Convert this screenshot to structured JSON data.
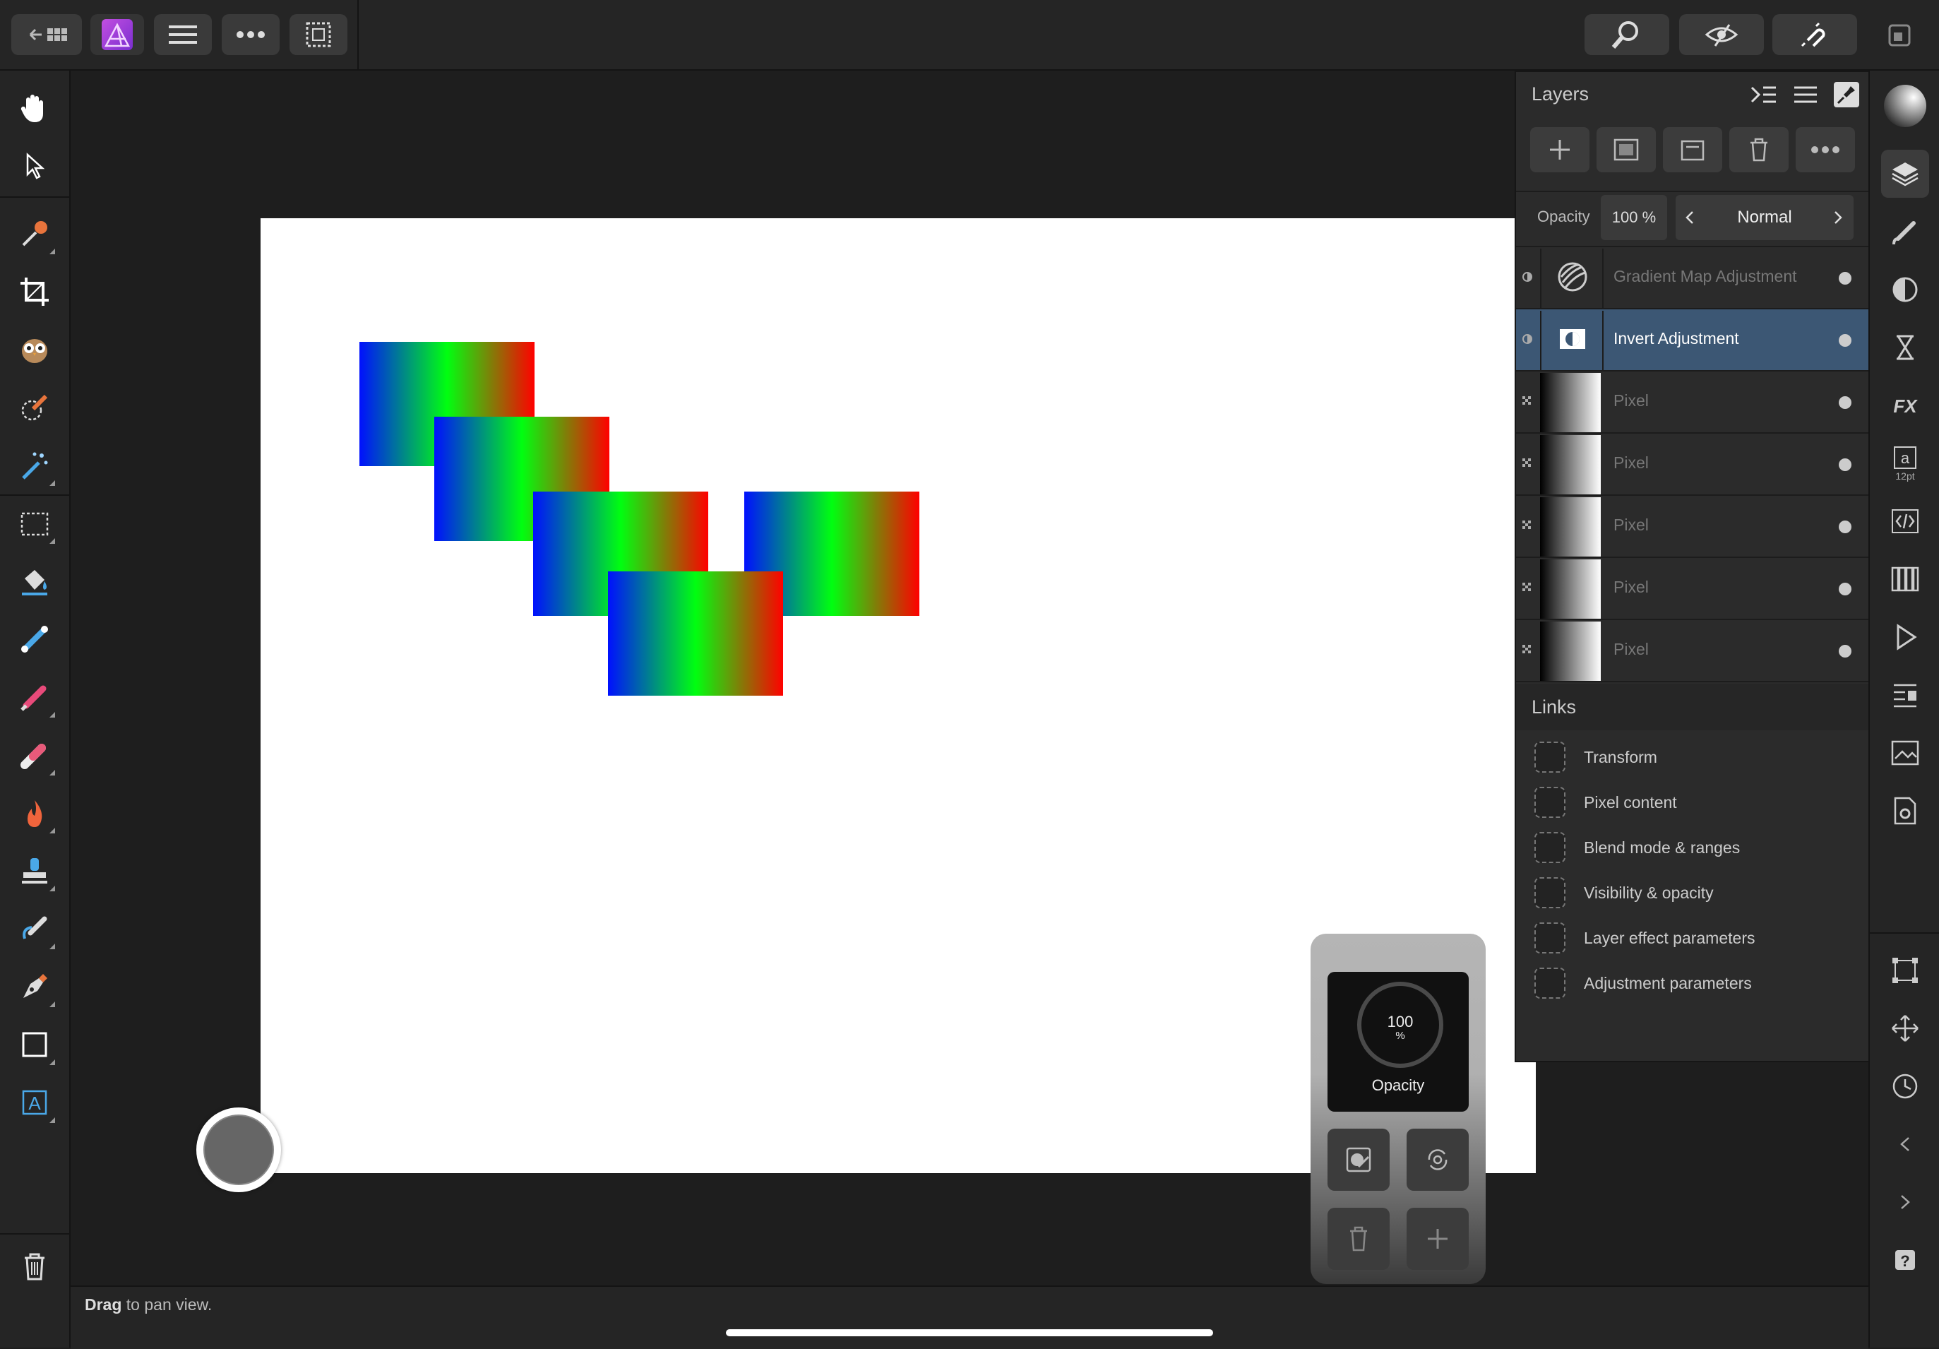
{
  "app": {
    "name": "Affinity Photo"
  },
  "layers_panel": {
    "title": "Layers",
    "opacity_label": "Opacity",
    "opacity_value": "100 %",
    "blend_mode": "Normal",
    "layers": [
      {
        "name": "Gradient Map Adjustment",
        "selected": false
      },
      {
        "name": "Invert Adjustment",
        "selected": true
      },
      {
        "name": "Pixel",
        "selected": false
      },
      {
        "name": "Pixel",
        "selected": false
      },
      {
        "name": "Pixel",
        "selected": false
      },
      {
        "name": "Pixel",
        "selected": false
      },
      {
        "name": "Pixel",
        "selected": false
      }
    ]
  },
  "links_panel": {
    "title": "Links",
    "items": [
      "Transform",
      "Pixel content",
      "Blend mode & ranges",
      "Visibility & opacity",
      "Layer effect parameters",
      "Adjustment parameters"
    ]
  },
  "hud": {
    "dial_value": "100",
    "dial_unit": "%",
    "dial_label": "Opacity"
  },
  "right_toolbar": {
    "char_panel_size": "12pt"
  },
  "status": {
    "bold": "Drag",
    "rest": " to pan view."
  },
  "colors": {
    "accent_selected": "#3c5774",
    "panel_bg": "#2b2b2b",
    "app_bg": "#1e1e1e"
  }
}
